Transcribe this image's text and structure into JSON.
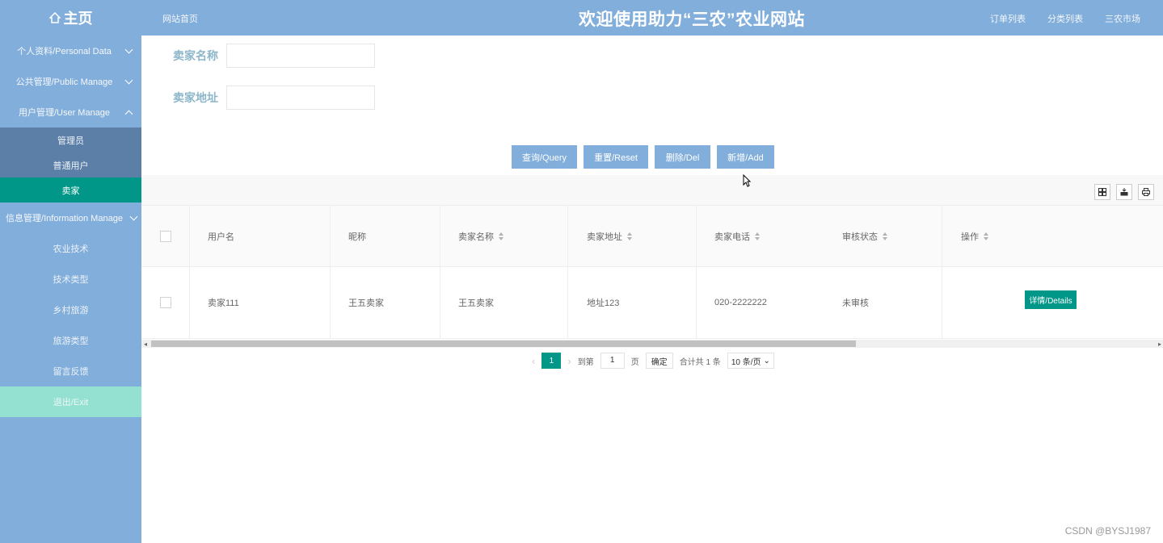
{
  "header": {
    "home_label": "主页",
    "site_home": "网站首页",
    "title": "欢迎使用助力“三农”农业网站",
    "links": [
      "订单列表",
      "分类列表",
      "三农市场"
    ]
  },
  "sidebar": {
    "groups": [
      {
        "label": "个人资料/Personal Data"
      },
      {
        "label": "公共管理/Public Manage"
      },
      {
        "label": "用户管理/User Manage",
        "sub": [
          "管理员",
          "普通用户",
          "卖家"
        ]
      },
      {
        "label": "信息管理/Information Manage",
        "sub": [
          "农业技术",
          "技术类型",
          "乡村旅游",
          "旅游类型",
          "留言反馈"
        ]
      }
    ],
    "exit_label": "退出/Exit"
  },
  "search": {
    "seller_name_label": "卖家名称",
    "seller_name_value": "",
    "seller_address_label": "卖家地址",
    "seller_address_value": ""
  },
  "actions": {
    "query": "查询/Query",
    "reset": "重置/Reset",
    "delete": "删除/Del",
    "add": "新增/Add"
  },
  "toolbar": {
    "icons": [
      "columns-icon",
      "export-icon",
      "print-icon"
    ]
  },
  "table": {
    "headers": [
      "用户名",
      "昵称",
      "卖家名称",
      "卖家地址",
      "卖家电话",
      "审核状态",
      "操作"
    ],
    "rows": [
      {
        "username": "卖家111",
        "nickname": "王五卖家",
        "seller_name": "王五卖家",
        "seller_address": "地址123",
        "seller_phone": "020-2222222",
        "status": "未审核",
        "action": "详情/Details"
      }
    ]
  },
  "pagination": {
    "current_page": "1",
    "goto_label": "到第",
    "goto_value": "1",
    "page_unit": "页",
    "confirm": "确定",
    "total": "合计共 1 条",
    "page_size": "10 条/页"
  },
  "watermark": "CSDN @BYSJ1987",
  "colors": {
    "sidebar": "#82aedb",
    "active": "#009688",
    "exit": "#94e0d1",
    "submenu": "#5b7fa6"
  }
}
